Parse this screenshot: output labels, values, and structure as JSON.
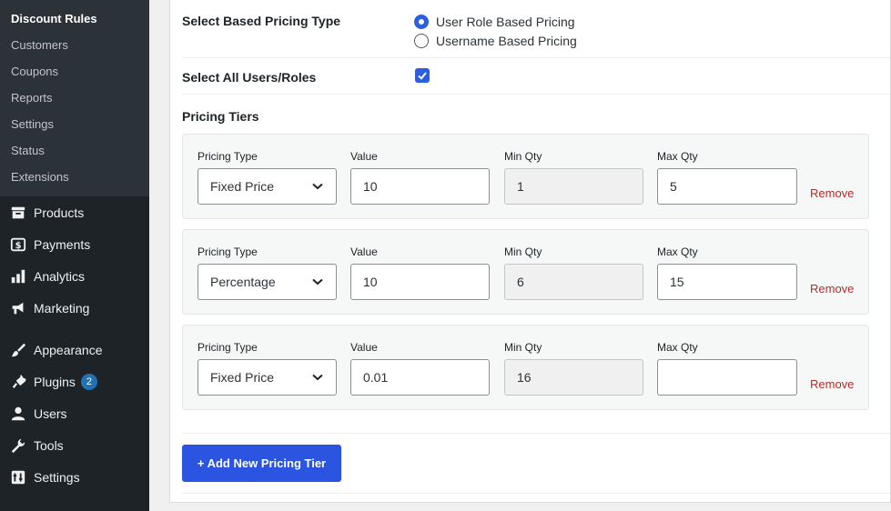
{
  "sidebar": {
    "submenu": [
      {
        "label": "Discount Rules",
        "current": true
      },
      {
        "label": "Customers"
      },
      {
        "label": "Coupons"
      },
      {
        "label": "Reports"
      },
      {
        "label": "Settings"
      },
      {
        "label": "Status"
      },
      {
        "label": "Extensions"
      }
    ],
    "menu": [
      {
        "label": "Products",
        "icon": "archive-icon"
      },
      {
        "label": "Payments",
        "icon": "payments-icon"
      },
      {
        "label": "Analytics",
        "icon": "bar-chart-icon"
      },
      {
        "label": "Marketing",
        "icon": "megaphone-icon"
      },
      {
        "label": "Appearance",
        "icon": "paintbrush-icon"
      },
      {
        "label": "Plugins",
        "icon": "plug-icon",
        "badge": "2"
      },
      {
        "label": "Users",
        "icon": "user-icon"
      },
      {
        "label": "Tools",
        "icon": "wrench-icon"
      },
      {
        "label": "Settings",
        "icon": "settings-sliders-icon"
      }
    ]
  },
  "form": {
    "pricing_type_label": "Select Based Pricing Type",
    "pricing_type_options": [
      {
        "label": "User Role Based Pricing",
        "selected": true
      },
      {
        "label": "Username Based Pricing",
        "selected": false
      }
    ],
    "select_all_label": "Select All Users/Roles",
    "select_all_checked": true,
    "tiers_heading": "Pricing Tiers",
    "column_labels": {
      "pricing_type": "Pricing Type",
      "value": "Value",
      "min_qty": "Min Qty",
      "max_qty": "Max Qty"
    },
    "tiers": [
      {
        "pricing_type": "Fixed Price",
        "value": "10",
        "min_qty": "1",
        "max_qty": "5",
        "remove": "Remove"
      },
      {
        "pricing_type": "Percentage",
        "value": "10",
        "min_qty": "6",
        "max_qty": "15",
        "remove": "Remove"
      },
      {
        "pricing_type": "Fixed Price",
        "value": "0.01",
        "min_qty": "16",
        "max_qty": "",
        "remove": "Remove"
      }
    ],
    "add_tier_label": "+ Add New Pricing Tier"
  },
  "colors": {
    "accent": "#2c5fe0",
    "remove": "#b32d2e",
    "sidebar_bg": "#1d2327"
  }
}
